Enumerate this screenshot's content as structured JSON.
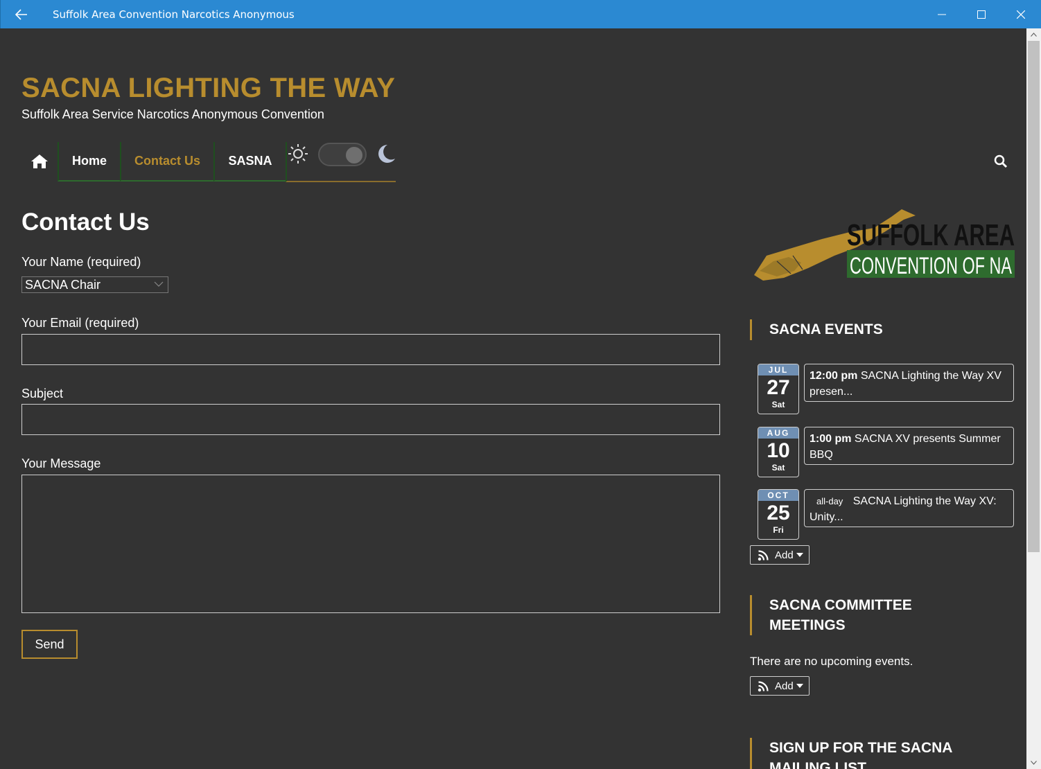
{
  "window": {
    "title": "Suffolk Area Convention Narcotics Anonymous",
    "back_icon": "arrow-left-icon",
    "controls": [
      "minimize-icon",
      "maximize-icon",
      "close-icon"
    ]
  },
  "site": {
    "title": "SACNA LIGHTING THE WAY",
    "tagline": "Suffolk Area Service Narcotics Anonymous Convention",
    "title_color": "#b88d2e"
  },
  "nav": {
    "home_icon": "home-icon",
    "items": [
      {
        "label": "Home",
        "active": false
      },
      {
        "label": "Contact Us",
        "active": true
      },
      {
        "label": "SASNA",
        "active": false
      }
    ],
    "theme_toggle": {
      "light_icon": "sun-icon",
      "dark_icon": "moon-icon",
      "state": "dark"
    },
    "search_icon": "search-icon"
  },
  "form": {
    "heading": "Contact Us",
    "name_label": "Your Name (required)",
    "name_value": "SACNA Chair",
    "email_label": "Your Email (required)",
    "email_value": "",
    "subject_label": "Subject",
    "subject_value": "",
    "message_label": "Your Message",
    "message_value": "",
    "send_label": "Send"
  },
  "sidebar": {
    "logo": {
      "line1": "SUFFOLK AREA",
      "line2": "CONVENTION OF NA"
    },
    "events_title": "SACNA EVENTS",
    "events": [
      {
        "month": "JUL",
        "day": "27",
        "dow": "Sat",
        "time": "12:00 pm",
        "title": "SACNA Lighting the Way XV presen..."
      },
      {
        "month": "AUG",
        "day": "10",
        "dow": "Sat",
        "time": "1:00 pm",
        "title": "SACNA XV presents Summer BBQ"
      },
      {
        "month": "OCT",
        "day": "25",
        "dow": "Fri",
        "time": "all-day",
        "title": "SACNA Lighting the Way XV: Unity..."
      }
    ],
    "add_label": "Add",
    "meetings_title": "SACNA COMMITTEE MEETINGS",
    "no_events": "There are no upcoming events.",
    "signup_title": "SIGN UP FOR THE SACNA MAILING LIST"
  }
}
